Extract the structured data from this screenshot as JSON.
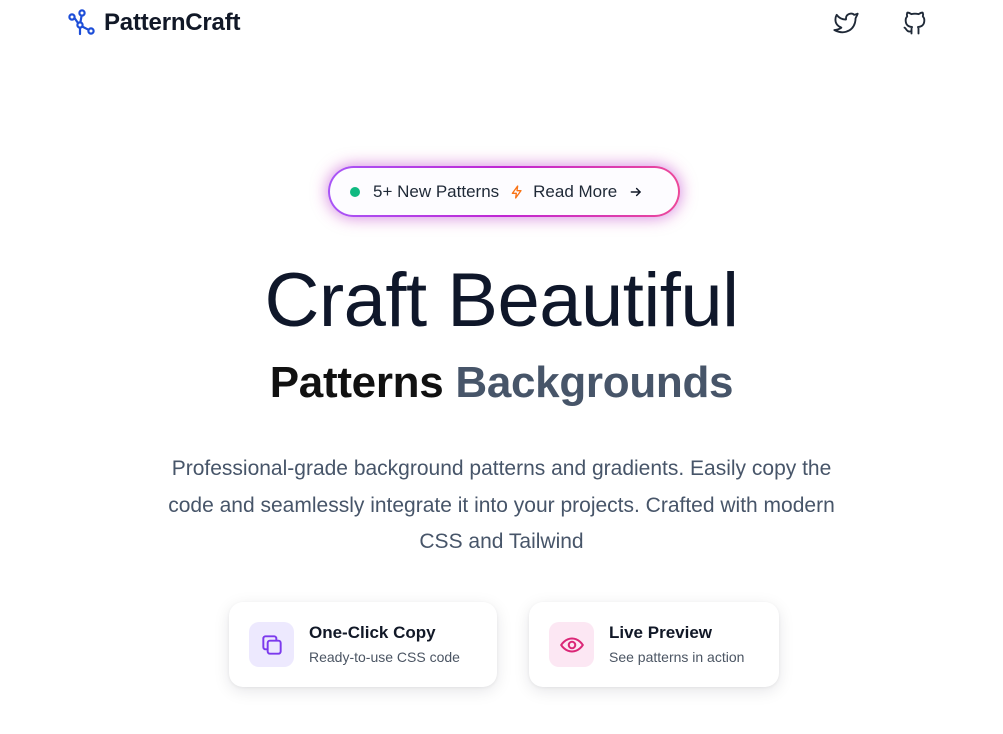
{
  "header": {
    "brand_name": "PatternCraft",
    "brand_icon": "network-nodes-icon",
    "social": [
      {
        "name": "twitter",
        "icon": "twitter-icon"
      },
      {
        "name": "github",
        "icon": "github-icon"
      }
    ]
  },
  "announcement": {
    "new_label": "5+ New Patterns",
    "read_more_label": "Read More",
    "status_color": "#10b981",
    "accent_icon": "lightning-bolt-icon",
    "arrow_icon": "arrow-right-icon"
  },
  "hero": {
    "title": "Craft Beautiful",
    "subtitle_a": "Patterns",
    "subtitle_b": "Backgrounds",
    "description": "Professional-grade background patterns and gradients. Easily copy the code and seamlessly integrate it into your projects. Crafted with modern CSS and Tailwind"
  },
  "features": [
    {
      "title": "One-Click Copy",
      "text": "Ready-to-use CSS code",
      "icon": "copy-icon",
      "color": "#7c3aed"
    },
    {
      "title": "Live Preview",
      "text": "See patterns in action",
      "icon": "eye-icon",
      "color": "#db2777"
    }
  ]
}
